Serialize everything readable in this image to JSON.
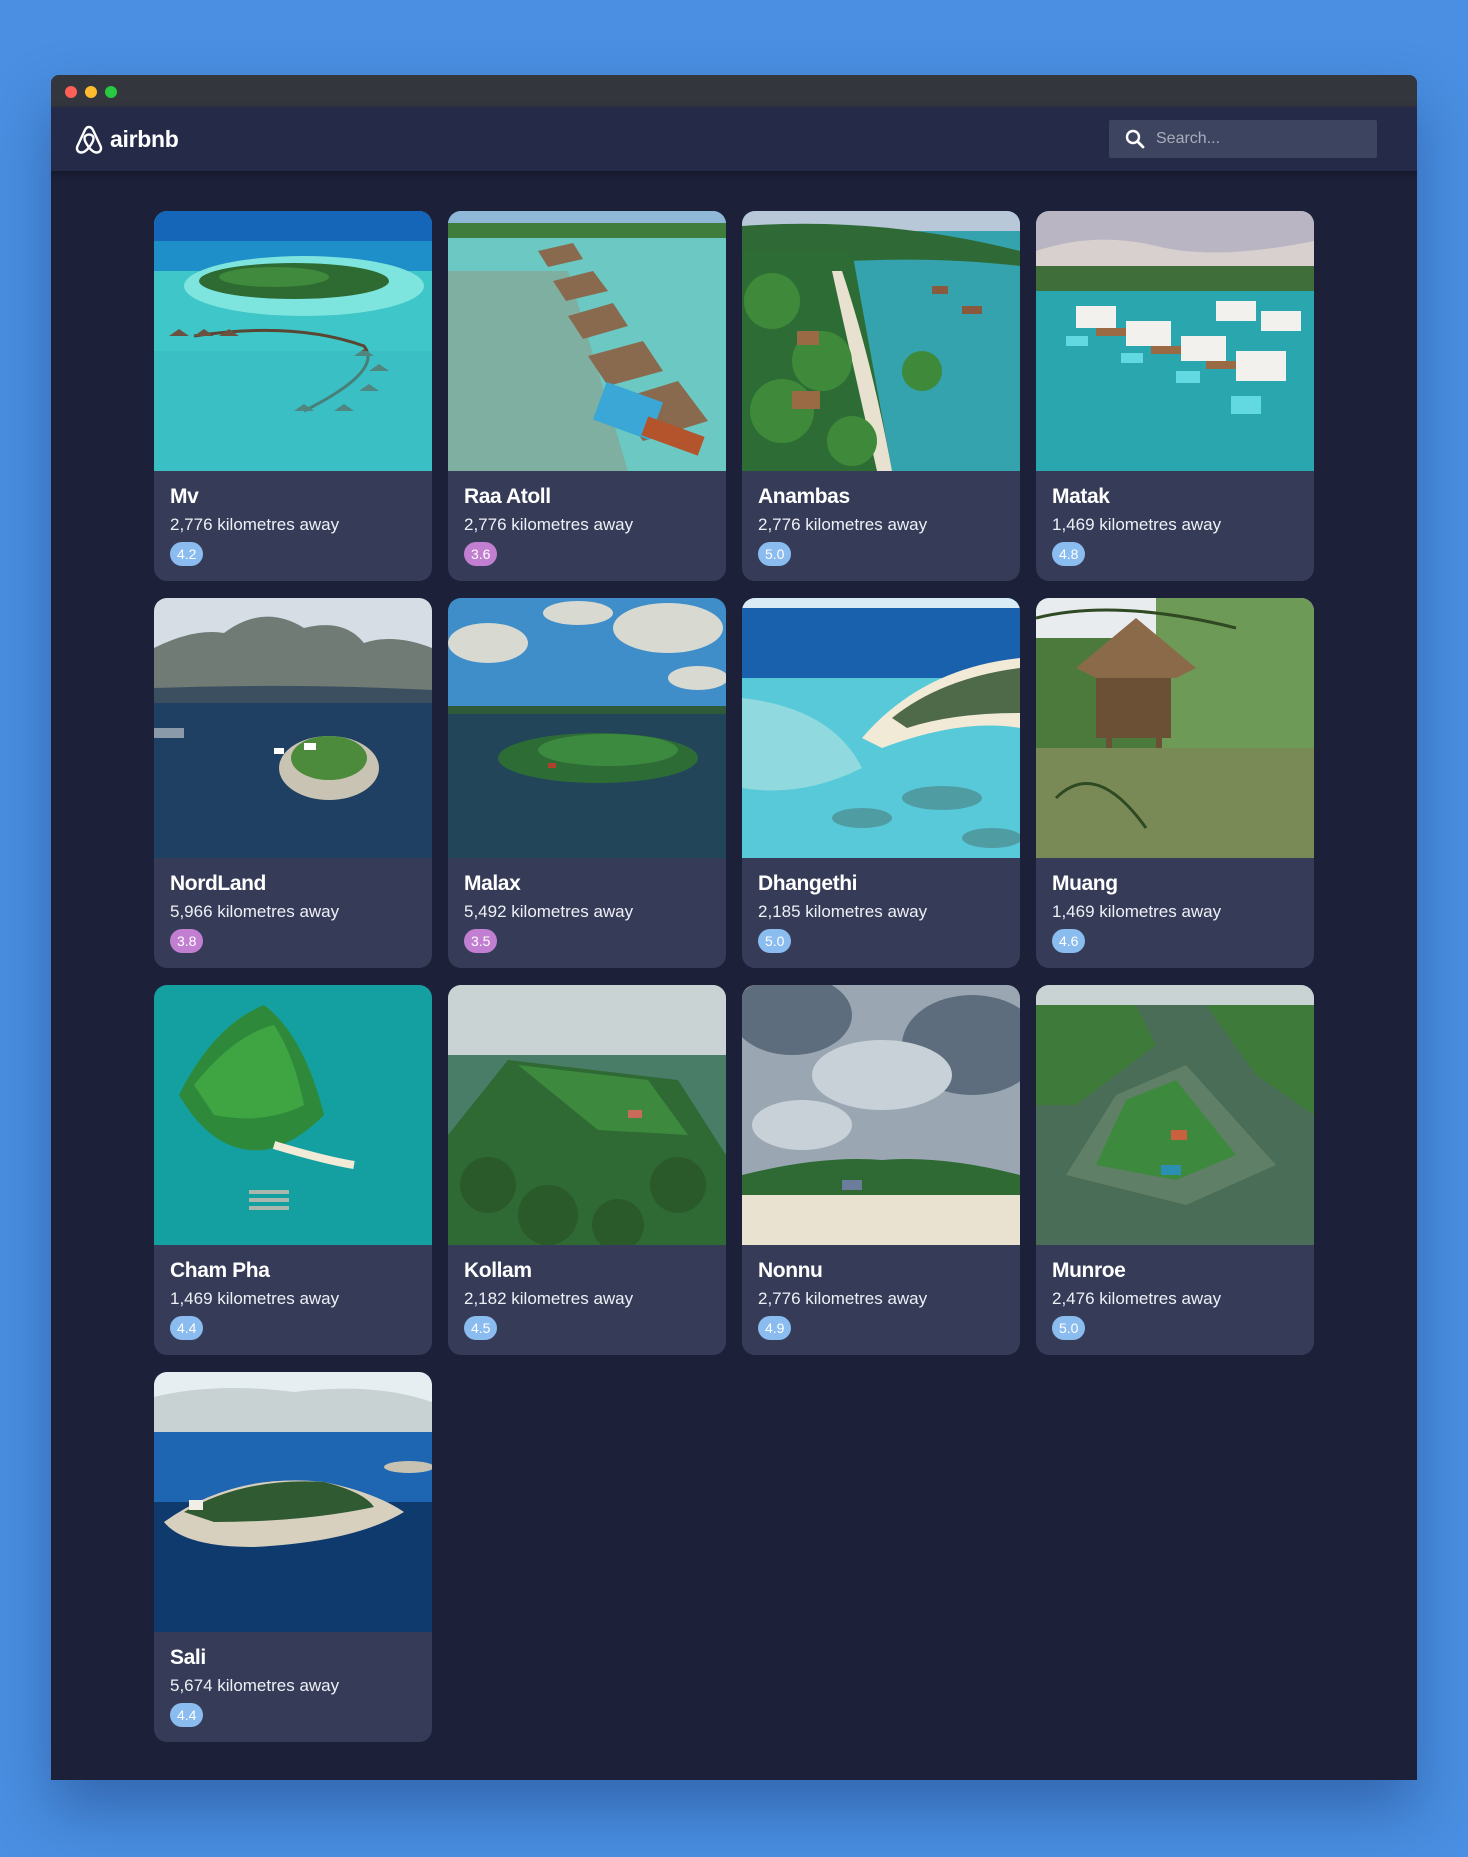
{
  "app": {
    "logo_text": "airbnb",
    "logo_icon": "airbnb-belo-icon"
  },
  "search": {
    "placeholder": "Search...",
    "icon": "search-icon"
  },
  "colors": {
    "page_background": "#4a8fe2",
    "app_background": "#1c2038",
    "navbar": "#242a48",
    "card": "#363c58",
    "badge_blue": "#8bbcf0",
    "badge_purple": "#c27fd2"
  },
  "listings": [
    {
      "name": "Mv",
      "distance": "2,776 kilometres away",
      "rating": "4.2",
      "badge_color": "#8bbcf0",
      "scene": "overwater-villas"
    },
    {
      "name": "Raa Atoll",
      "distance": "2,776 kilometres away",
      "rating": "3.6",
      "badge_color": "#c27fd2",
      "scene": "overwater-bungalows"
    },
    {
      "name": "Anambas",
      "distance": "2,776 kilometres away",
      "rating": "5.0",
      "badge_color": "#8bbcf0",
      "scene": "palm-beach"
    },
    {
      "name": "Matak",
      "distance": "1,469 kilometres away",
      "rating": "4.8",
      "badge_color": "#8bbcf0",
      "scene": "white-villas"
    },
    {
      "name": "NordLand",
      "distance": "5,966 kilometres away",
      "rating": "3.8",
      "badge_color": "#c27fd2",
      "scene": "fjord-island"
    },
    {
      "name": "Malax",
      "distance": "5,492 kilometres away",
      "rating": "3.5",
      "badge_color": "#c27fd2",
      "scene": "forest-island"
    },
    {
      "name": "Dhangethi",
      "distance": "2,185 kilometres away",
      "rating": "5.0",
      "badge_color": "#8bbcf0",
      "scene": "atoll-lagoon"
    },
    {
      "name": "Muang",
      "distance": "1,469 kilometres away",
      "rating": "4.6",
      "badge_color": "#8bbcf0",
      "scene": "jungle-hut"
    },
    {
      "name": "Cham Pha",
      "distance": "1,469 kilometres away",
      "rating": "4.4",
      "badge_color": "#8bbcf0",
      "scene": "green-island"
    },
    {
      "name": "Kollam",
      "distance": "2,182 kilometres away",
      "rating": "4.5",
      "badge_color": "#8bbcf0",
      "scene": "backwater-island"
    },
    {
      "name": "Nonnu",
      "distance": "2,776 kilometres away",
      "rating": "4.9",
      "badge_color": "#8bbcf0",
      "scene": "cloudy-beach"
    },
    {
      "name": "Munroe",
      "distance": "2,476 kilometres away",
      "rating": "5.0",
      "badge_color": "#8bbcf0",
      "scene": "river-island"
    },
    {
      "name": "Sali",
      "distance": "5,674 kilometres away",
      "rating": "4.4",
      "badge_color": "#8bbcf0",
      "scene": "rocky-island"
    }
  ]
}
